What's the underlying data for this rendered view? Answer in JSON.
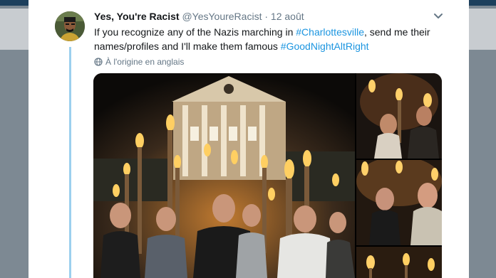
{
  "tweet": {
    "author_name": "Yes, You're Racist",
    "handle": "@YesYoureRacist",
    "separator": "·",
    "timestamp": "12 août",
    "text_part1": "If you recognize any of the Nazis marching in ",
    "hashtag1": "#Charlottesville",
    "text_part2": ", send me their names/profiles and I'll make them famous ",
    "hashtag2": "#GoodNightAltRight",
    "translate_label": "À l'origine en anglais"
  },
  "colors": {
    "link": "#1b95e0",
    "thread_line": "#9cd0ee",
    "secondary_text": "#657786",
    "top_bar": "#1c3f5c"
  },
  "icons": {
    "menu": "chevron-down-icon",
    "translate": "globe-icon"
  }
}
